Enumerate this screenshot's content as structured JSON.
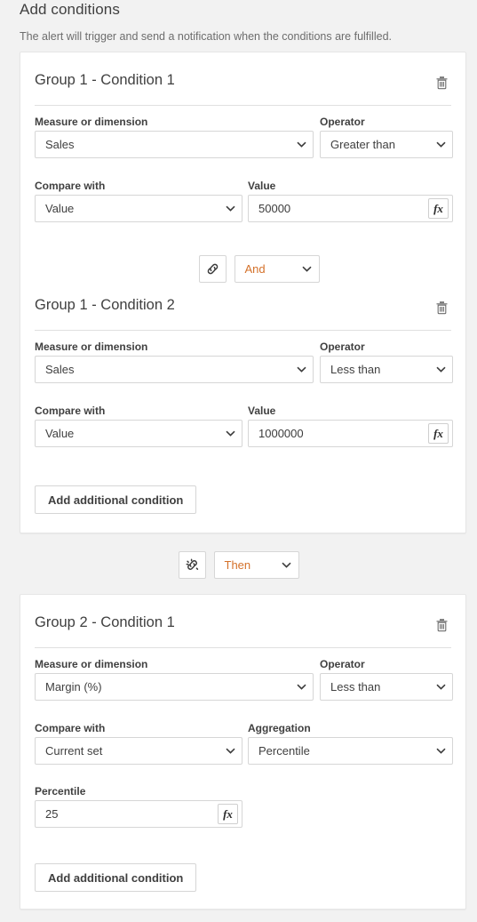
{
  "header": {
    "title": "Add conditions",
    "subtitle": "The alert will trigger and send a notification when the conditions are fulfilled."
  },
  "labels": {
    "measure_or_dimension": "Measure or dimension",
    "operator": "Operator",
    "compare_with": "Compare with",
    "value": "Value",
    "aggregation": "Aggregation",
    "percentile": "Percentile"
  },
  "buttons": {
    "add_additional_condition": "Add additional condition",
    "fx": "fx",
    "delete_icon": "trash-icon",
    "link_icon": "link-icon",
    "broken_link_icon": "broken-link-icon"
  },
  "colors": {
    "page_background": "#f2f2f2",
    "card_background": "#ffffff",
    "border": "#d6d6d6",
    "text": "#404040",
    "muted_text": "#6d6d6d",
    "connector_accent": "#d4712a"
  },
  "groups": [
    {
      "card_index": 1,
      "conditions": [
        {
          "title": "Group 1 - Condition 1",
          "measure": "Sales",
          "operator": "Greater than",
          "compare_with": "Value",
          "second_label": "Value",
          "second_value": "50000",
          "second_kind": "input"
        },
        {
          "title": "Group 1 - Condition 2",
          "measure": "Sales",
          "operator": "Less than",
          "compare_with": "Value",
          "second_label": "Value",
          "second_value": "1000000",
          "second_kind": "input"
        }
      ],
      "inner_connector": {
        "operator": "And",
        "icon": "link-icon"
      },
      "add_button": "Add additional condition"
    },
    {
      "card_index": 2,
      "conditions": [
        {
          "title": "Group 2 - Condition 1",
          "measure": "Margin (%)",
          "operator": "Less than",
          "compare_with": "Current set",
          "second_label": "Aggregation",
          "second_value": "Percentile",
          "second_kind": "select",
          "extra_label": "Percentile",
          "extra_value": "25"
        }
      ],
      "add_button": "Add additional condition"
    }
  ],
  "group_connector": {
    "operator": "Then",
    "icon": "broken-link-icon"
  }
}
